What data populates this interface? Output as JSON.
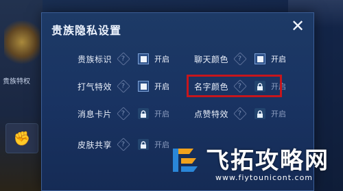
{
  "background": {
    "side_label": "贵族特权"
  },
  "dialog": {
    "title": "贵族隐私设置",
    "close_symbol": "✕"
  },
  "settings": [
    {
      "name": "贵族标识",
      "state": "开启",
      "enabled": true,
      "locked": false
    },
    {
      "name": "聊天颜色",
      "state": "开启",
      "enabled": true,
      "locked": false
    },
    {
      "name": "打气特效",
      "state": "开启",
      "enabled": true,
      "locked": false
    },
    {
      "name": "名字颜色",
      "state": "开启",
      "enabled": false,
      "locked": true
    },
    {
      "name": "消息卡片",
      "state": "开启",
      "enabled": false,
      "locked": true
    },
    {
      "name": "点赞特效",
      "state": "开启",
      "enabled": false,
      "locked": true
    },
    {
      "name": "皮肤共享",
      "state": "开启",
      "enabled": false,
      "locked": true
    }
  ],
  "watermark": {
    "brand": "飞拓攻略网",
    "url": "www.fiytounicont.com"
  },
  "colors": {
    "dialog_bg": "#1b3663",
    "highlight": "#c7161c",
    "toggle_on": "#2c4f86",
    "lock_bg": "#23456f"
  }
}
